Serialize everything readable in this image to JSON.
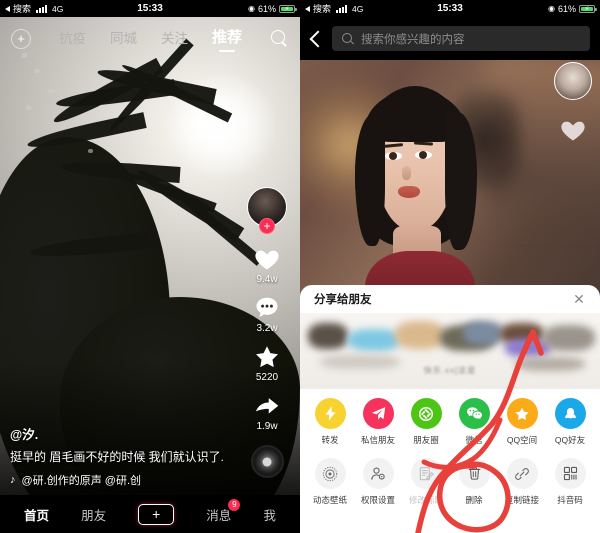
{
  "status_bar": {
    "back_label": "搜索",
    "network": "4G",
    "time": "15:33",
    "battery_percent": "61%",
    "battery_charging": true
  },
  "left_panel": {
    "nav": {
      "add_icon": "plus-circle-icon",
      "tabs": [
        {
          "label": "抗疫",
          "active": false
        },
        {
          "label": "同城",
          "active": false
        },
        {
          "label": "关注",
          "active": false
        },
        {
          "label": "推荐",
          "active": true
        }
      ],
      "search_icon": "search-icon"
    },
    "video": {
      "scene": "palm trees silhouetted against bright overcast sky",
      "username": "@汐.",
      "caption": "挺早的 眉毛画不好的时候 我们就认识了.",
      "music": "@研.创作的原声    @研.创",
      "music_icon": "music-note-icon"
    },
    "rail": {
      "follow_badge": "+",
      "like_count": "9.4w",
      "comment_count": "3.2w",
      "favorite_count": "5220",
      "share_count": "1.9w",
      "like_icon": "heart-icon",
      "comment_icon": "comment-bubble-icon",
      "favorite_icon": "star-icon",
      "share_icon": "share-arrow-icon",
      "disc_icon": "music-disc-icon"
    },
    "tabbar": [
      {
        "label": "首页",
        "active": true,
        "badge": ""
      },
      {
        "label": "朋友",
        "active": false,
        "badge": ""
      },
      {
        "label": "+",
        "active": false,
        "badge": "",
        "is_create": true
      },
      {
        "label": "消息",
        "active": false,
        "badge": "9"
      },
      {
        "label": "我",
        "active": false,
        "badge": ""
      }
    ]
  },
  "right_panel": {
    "nav": {
      "back_icon": "back-chevron-icon",
      "search_icon": "search-icon",
      "search_placeholder": "搜索你感兴趣的内容",
      "search_value": ""
    },
    "video": {
      "scene": "close-up of a person looking upward, warm blurred indoor background"
    },
    "share_sheet": {
      "title": "分享给朋友",
      "close_icon": "close-icon",
      "preview_caption": "快乐.xx[这是",
      "share_targets": [
        {
          "label": "转发",
          "icon": "lightning-bolt-icon",
          "color": "#f8d231"
        },
        {
          "label": "私信朋友",
          "icon": "paper-plane-icon",
          "color": "#f6335c"
        },
        {
          "label": "朋友圈",
          "icon": "moments-camera-icon",
          "color": "#4cc514"
        },
        {
          "label": "微信",
          "icon": "wechat-icon",
          "color": "#2bbf4a"
        },
        {
          "label": "QQ空间",
          "icon": "qzone-star-icon",
          "color": "#fbab18"
        },
        {
          "label": "QQ好友",
          "icon": "qq-penguin-icon",
          "color": "#1aa8e8"
        }
      ],
      "actions": [
        {
          "label": "动态壁纸",
          "icon": "live-wallpaper-icon",
          "disabled": false,
          "highlighted": false
        },
        {
          "label": "权限设置",
          "icon": "permission-user-icon",
          "disabled": false,
          "highlighted": false
        },
        {
          "label": "修改标题",
          "icon": "edit-title-icon",
          "disabled": true,
          "highlighted": false
        },
        {
          "label": "删除",
          "icon": "trash-icon",
          "disabled": false,
          "highlighted": true
        },
        {
          "label": "复制链接",
          "icon": "link-icon",
          "disabled": false,
          "highlighted": false
        },
        {
          "label": "抖音码",
          "icon": "qr-code-icon",
          "disabled": false,
          "highlighted": false
        }
      ]
    }
  },
  "annotation": {
    "circle_color": "#e8403a",
    "arrow_color": "#e8403a",
    "target": "删除"
  }
}
